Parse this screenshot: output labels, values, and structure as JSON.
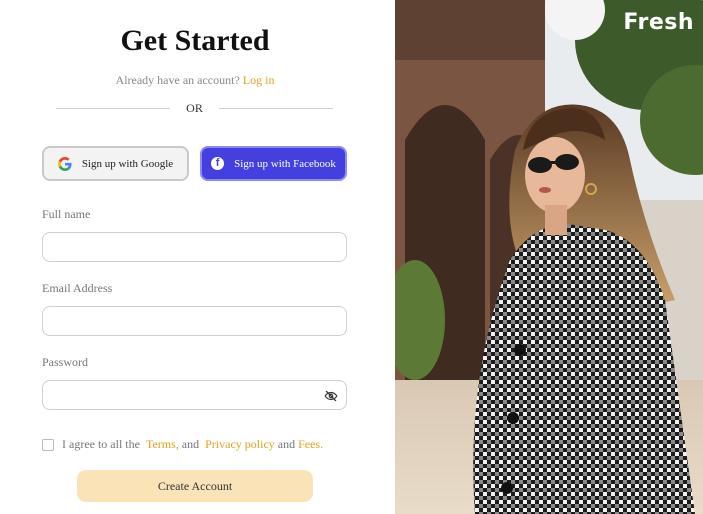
{
  "header": {
    "title": "Get Started",
    "already_text": "Already have an account?",
    "login_link": "Log in",
    "or_text": "OR"
  },
  "social": {
    "google_label": "Sign up with Google",
    "facebook_label": "Sign up with Facebook",
    "facebook_color": "#4440e0"
  },
  "form": {
    "full_name_label": "Full name",
    "full_name_value": "",
    "email_label": "Email Address",
    "email_value": "",
    "password_label": "Password",
    "password_value": "",
    "password_toggle_icon": "eye-off-icon"
  },
  "agreement": {
    "prefix": "I agree to all the",
    "terms": "Terms,",
    "and1": "and",
    "privacy": "Privacy policy",
    "and2": "and",
    "fees": "Fees.",
    "checked": false
  },
  "submit_label": "Create Account",
  "accent_color": "#e2a21c",
  "brand": {
    "name": "Fresh"
  }
}
